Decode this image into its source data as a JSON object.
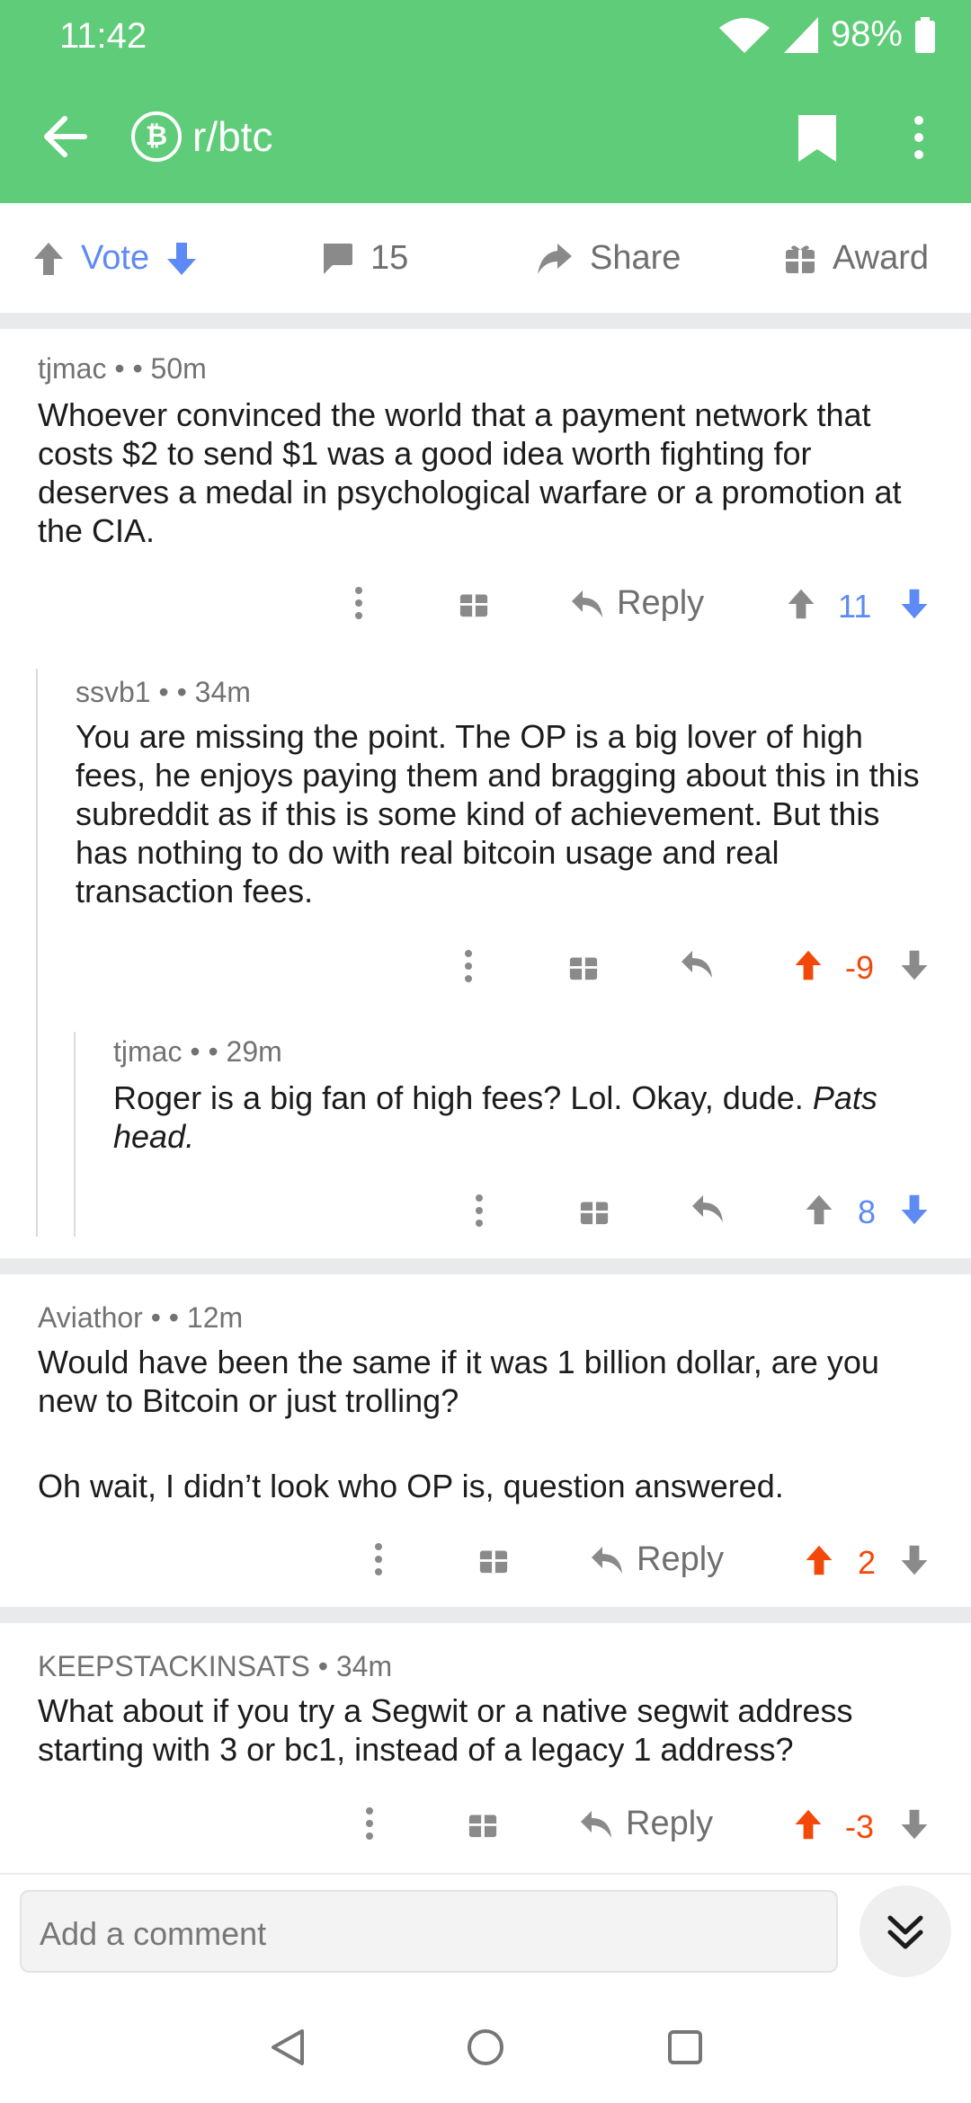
{
  "status": {
    "time": "11:42",
    "battery": "98%"
  },
  "header": {
    "subreddit": "r/btc",
    "btc_symbol": "₿"
  },
  "post_actions": {
    "vote_label": "Vote",
    "comment_count": "15",
    "share_label": "Share",
    "award_label": "Award"
  },
  "comments": [
    {
      "author": "tjmac",
      "time": "50m",
      "meta": "tjmac •  • 50m",
      "body": "Whoever convinced the world that a payment network that costs $2 to send $1 was a good idea worth fighting for deserves a medal in psychological warfare or a promotion at the CIA.",
      "reply_label": "Reply",
      "score": "11",
      "vote_state": "none"
    },
    {
      "author": "ssvb1",
      "time": "34m",
      "meta": "ssvb1 •  • 34m",
      "body": "You are missing the point. The OP is a big lover of high fees, he enjoys paying them and bragging about this in this subreddit as if this is some kind of achievement. But this has nothing to do with real bitcoin usage and real transaction fees.",
      "score": "-9",
      "vote_state": "up"
    },
    {
      "author": "tjmac",
      "time": "29m",
      "meta": "tjmac •  • 29m",
      "body_plain": "Roger is a big fan of high fees? Lol. Okay, dude. ",
      "body_italic": "Pats head.",
      "score": "8",
      "vote_state": "none"
    },
    {
      "author": "Aviathor",
      "time": "12m",
      "meta": "Aviathor •  • 12m",
      "body_p1": "Would have been the same if it was 1 billion dollar, are you new to Bitcoin or just trolling?",
      "body_p2": "Oh wait, I didn’t look who OP is, question answered.",
      "reply_label": "Reply",
      "score": "2",
      "vote_state": "up"
    },
    {
      "author": "KEEPSTACKINSATS",
      "time": "34m",
      "meta": "KEEPSTACKINSATS • 34m",
      "body": "What about if you try a Segwit or a native segwit address starting with 3 or bc1, instead of a legacy 1 address?",
      "reply_label": "Reply",
      "score": "-3",
      "vote_state": "up"
    }
  ],
  "composer": {
    "placeholder": "Add a comment"
  },
  "colors": {
    "brand_green": "#5ecc78",
    "vote_blue": "#5e8af5",
    "upvote_orange": "#f2490a",
    "neutral_gray": "#8a8a8a"
  },
  "icons": [
    "back-arrow-icon",
    "bitcoin-icon",
    "bookmark-icon",
    "more-vertical-icon",
    "upvote-arrow-icon",
    "downvote-arrow-icon",
    "comment-bubble-icon",
    "share-arrow-icon",
    "award-gift-icon",
    "reply-arrow-icon",
    "chevron-double-down-icon",
    "nav-back-icon",
    "nav-home-icon",
    "nav-recents-icon"
  ]
}
